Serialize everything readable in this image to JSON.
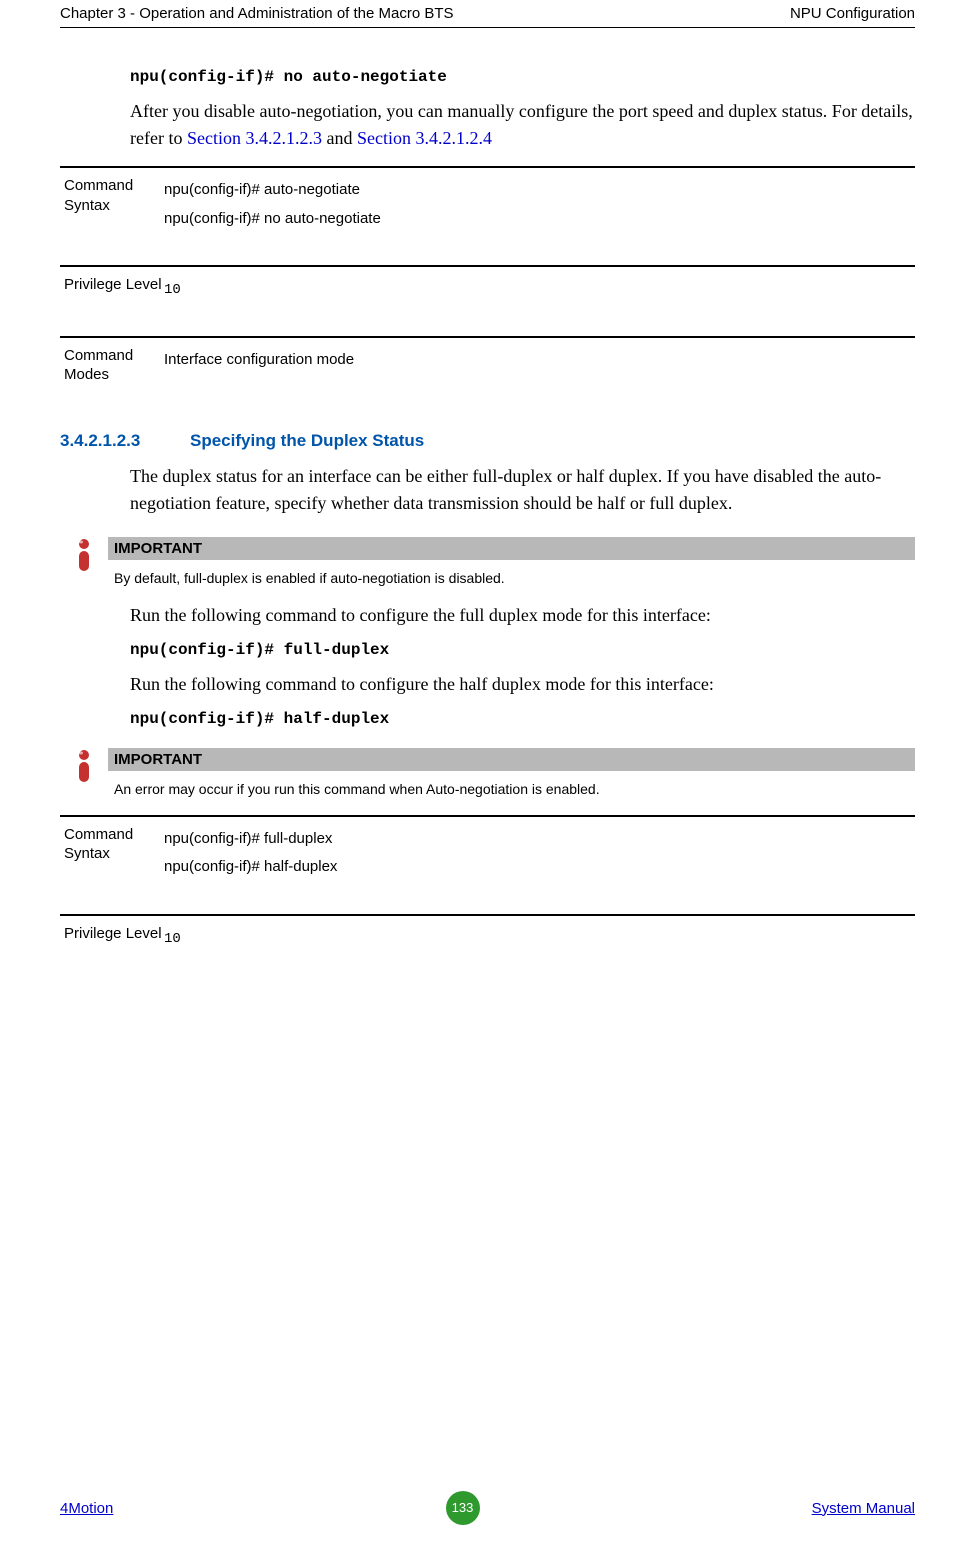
{
  "header": {
    "left": "Chapter 3 - Operation and Administration of the Macro BTS",
    "right": "NPU Configuration"
  },
  "intro": {
    "code": "npu(config-if)# no auto-negotiate",
    "para_pre": "After you disable auto-negotiation, you can manually configure the port speed and duplex status. For details, refer to ",
    "link1": "Section 3.4.2.1.2.3",
    "and": " and ",
    "link2": "Section 3.4.2.1.2.4"
  },
  "def1": {
    "label_syntax": "Command Syntax",
    "syntax_l1": "npu(config-if)# auto-negotiate",
    "syntax_l2": "npu(config-if)# no auto-negotiate",
    "label_priv": "Privilege Level",
    "priv": "10",
    "label_modes": "Command Modes",
    "modes": "Interface configuration mode"
  },
  "section": {
    "num": "3.4.2.1.2.3",
    "title": "Specifying the Duplex Status",
    "para1": "The duplex status for an interface can be either full-duplex or half duplex. If you have disabled the auto-negotiation feature, specify whether data transmission should be half or full duplex.",
    "para2": "Run the following command to configure the full duplex mode for this interface:",
    "code2": "npu(config-if)# full-duplex",
    "para3": "Run the following command to configure the half duplex mode for this interface:",
    "code3": "npu(config-if)# half-duplex"
  },
  "note1": {
    "title": "IMPORTANT",
    "body": "By default, full-duplex is enabled if auto-negotiation is disabled."
  },
  "note2": {
    "title": "IMPORTANT",
    "body": "An error may occur if you run this command when Auto-negotiation is enabled."
  },
  "def2": {
    "label_syntax": "Command Syntax",
    "syntax_l1": "npu(config-if)# full-duplex",
    "syntax_l2": "npu(config-if)# half-duplex",
    "label_priv": "Privilege Level",
    "priv": "10"
  },
  "footer": {
    "left": "4Motion",
    "page": "133",
    "right": " System Manual"
  }
}
